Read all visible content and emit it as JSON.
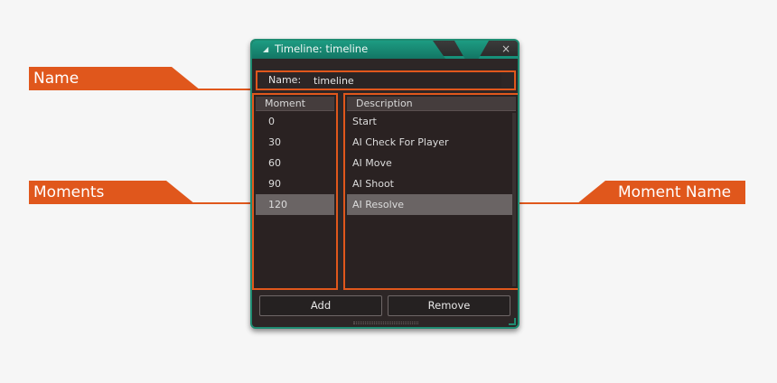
{
  "annotations": {
    "name": "Name",
    "moments": "Moments",
    "moment_name": "Moment Name",
    "color": "#e0571c"
  },
  "window": {
    "title": "Timeline: timeline",
    "close_icon": "×",
    "accent_color": "#1f8c72"
  },
  "name_field": {
    "label": "Name:",
    "value": "timeline"
  },
  "moments": {
    "header": "Moment",
    "items": [
      "0",
      "30",
      "60",
      "90",
      "120"
    ],
    "selected_index": 4
  },
  "descriptions": {
    "header": "Description",
    "items": [
      "Start",
      "AI Check For Player",
      "AI Move",
      "AI Shoot",
      "AI Resolve"
    ]
  },
  "buttons": {
    "add": "Add",
    "remove": "Remove"
  }
}
